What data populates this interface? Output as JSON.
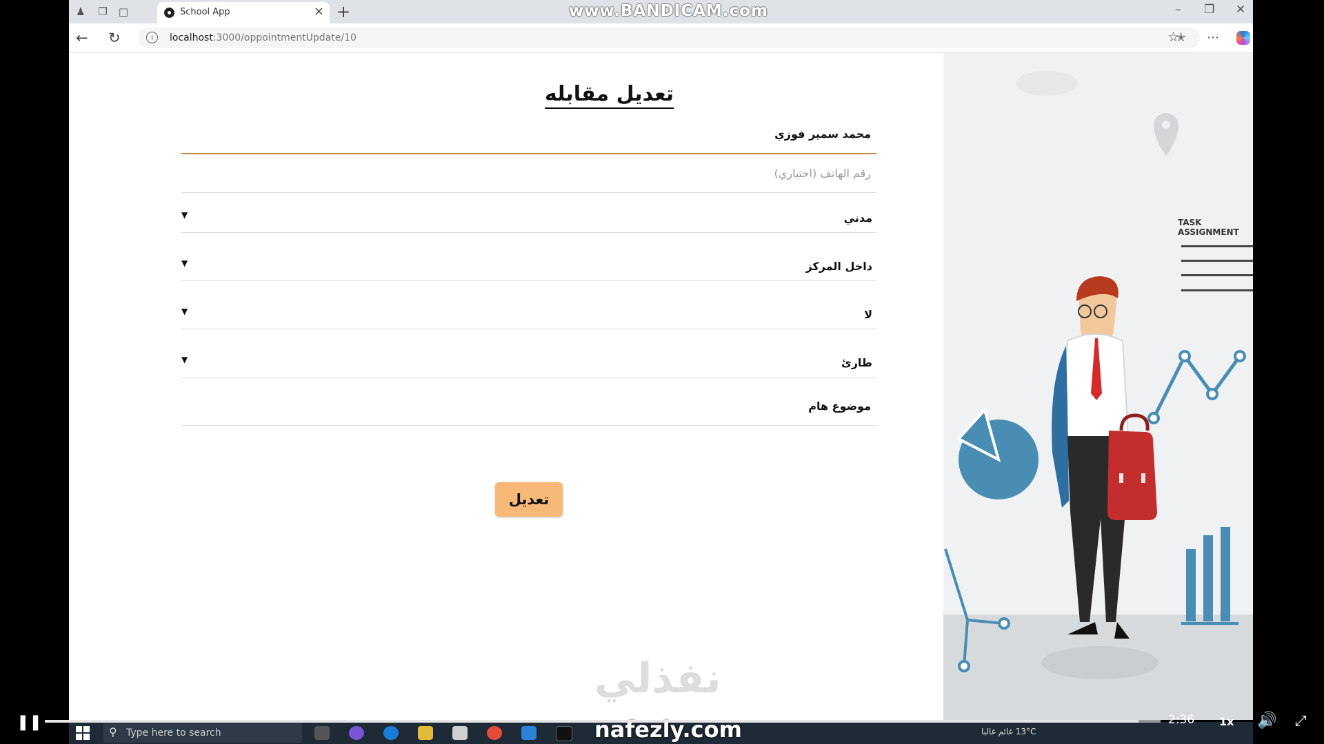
{
  "browser": {
    "tab_title": "School App",
    "url_host": "localhost",
    "url_path": ":3000/oppointmentUpdate/10",
    "watermark": "www.BANDICAM.com"
  },
  "form": {
    "title": "تعديل مقابله",
    "name_value": "محمد سمير فوزي",
    "phone_placeholder": "رقم الهاتف (اختياري)",
    "select_1": "مدني",
    "select_2": "داخل المركز",
    "select_3": "لا",
    "select_4": "طارئ",
    "subject_value": "موضوع هام",
    "submit_label": "تعديل"
  },
  "illustration": {
    "label": "TASK ASSIGNMENT"
  },
  "overlay": {
    "watermark_arabic": "نفذلي",
    "watermark_site": "nafezly.com"
  },
  "player": {
    "time": "2:36",
    "speed": "1x",
    "progress": 0.98
  },
  "taskbar": {
    "search_placeholder": "Type here to search",
    "weather": "13°C غائم غالبا"
  }
}
